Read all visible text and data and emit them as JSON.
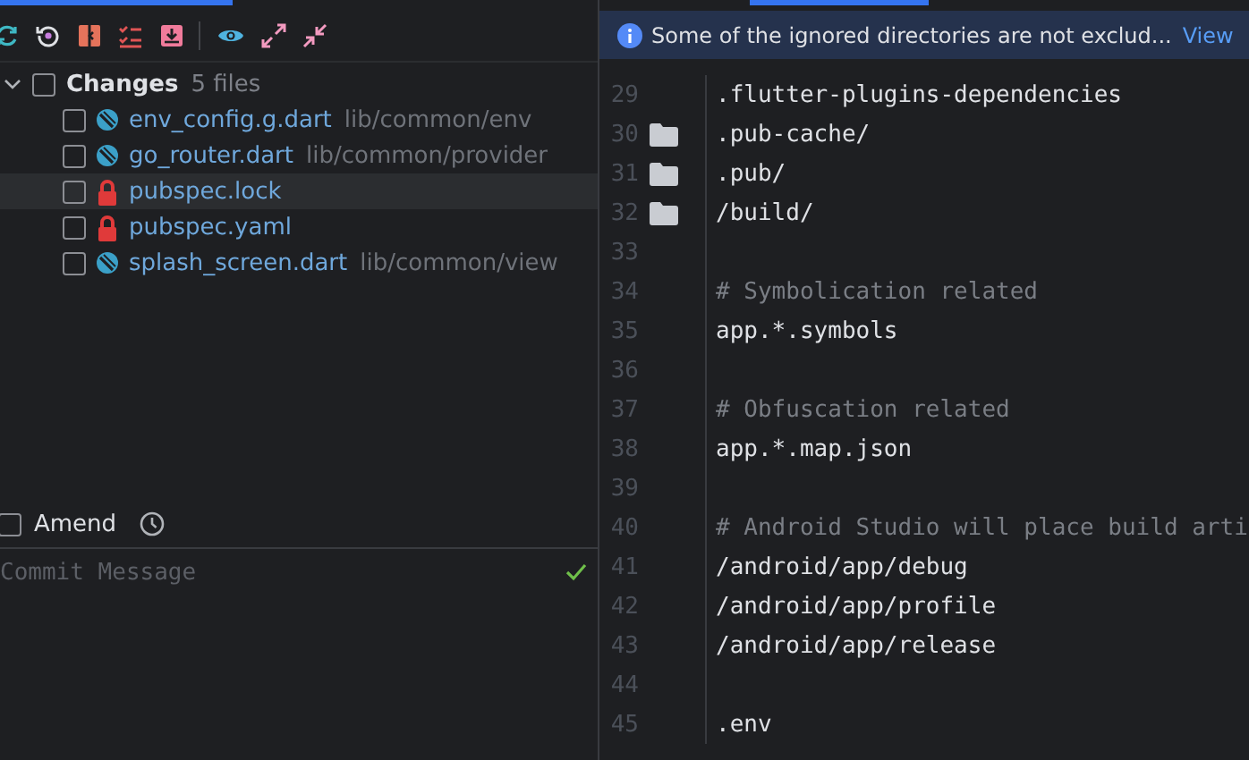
{
  "changes_panel": {
    "group": {
      "label": "Changes",
      "count": "5 files",
      "expanded": true,
      "checked": false
    },
    "files": [
      {
        "name": "env_config.g.dart",
        "path": "lib/common/env",
        "kind": "dart",
        "checked": false,
        "selected": false
      },
      {
        "name": "go_router.dart",
        "path": "lib/common/provider",
        "kind": "dart",
        "checked": false,
        "selected": false
      },
      {
        "name": "pubspec.lock",
        "kind": "locked",
        "checked": false,
        "selected": true
      },
      {
        "name": "pubspec.yaml",
        "kind": "locked",
        "checked": false,
        "selected": false
      },
      {
        "name": "splash_screen.dart",
        "path": "lib/common/view",
        "kind": "dart",
        "checked": false,
        "selected": false
      }
    ]
  },
  "commit": {
    "amend": {
      "label": "Amend",
      "checked": false
    },
    "message": {
      "placeholder": "Commit Message"
    }
  },
  "editor": {
    "banner": {
      "text": "Some of the ignored directories are not exclud...",
      "link": "View"
    },
    "lines": [
      {
        "number": "29",
        "text": ".flutter-plugins-dependencies",
        "kind": "code",
        "folder": false
      },
      {
        "number": "30",
        "text": ".pub-cache/",
        "kind": "code",
        "folder": true
      },
      {
        "number": "31",
        "text": ".pub/",
        "kind": "code",
        "folder": true
      },
      {
        "number": "32",
        "text": "/build/",
        "kind": "code",
        "folder": true
      },
      {
        "number": "33",
        "kind": "blank",
        "folder": false
      },
      {
        "number": "34",
        "text": "# Symbolication related",
        "kind": "comment",
        "folder": false
      },
      {
        "number": "35",
        "text": "app.*.symbols",
        "kind": "code",
        "folder": false
      },
      {
        "number": "36",
        "kind": "blank",
        "folder": false
      },
      {
        "number": "37",
        "text": "# Obfuscation related",
        "kind": "comment",
        "folder": false
      },
      {
        "number": "38",
        "text": "app.*.map.json",
        "kind": "code",
        "folder": false
      },
      {
        "number": "39",
        "kind": "blank",
        "folder": false
      },
      {
        "number": "40",
        "text": "# Android Studio will place build arti",
        "kind": "comment",
        "folder": false
      },
      {
        "number": "41",
        "text": "/android/app/debug",
        "kind": "code",
        "folder": false
      },
      {
        "number": "42",
        "text": "/android/app/profile",
        "kind": "code",
        "folder": false
      },
      {
        "number": "43",
        "text": "/android/app/release",
        "kind": "code",
        "folder": false
      },
      {
        "number": "44",
        "kind": "blank",
        "folder": false
      },
      {
        "number": "45",
        "text": ".env",
        "kind": "code",
        "folder": false
      }
    ]
  }
}
